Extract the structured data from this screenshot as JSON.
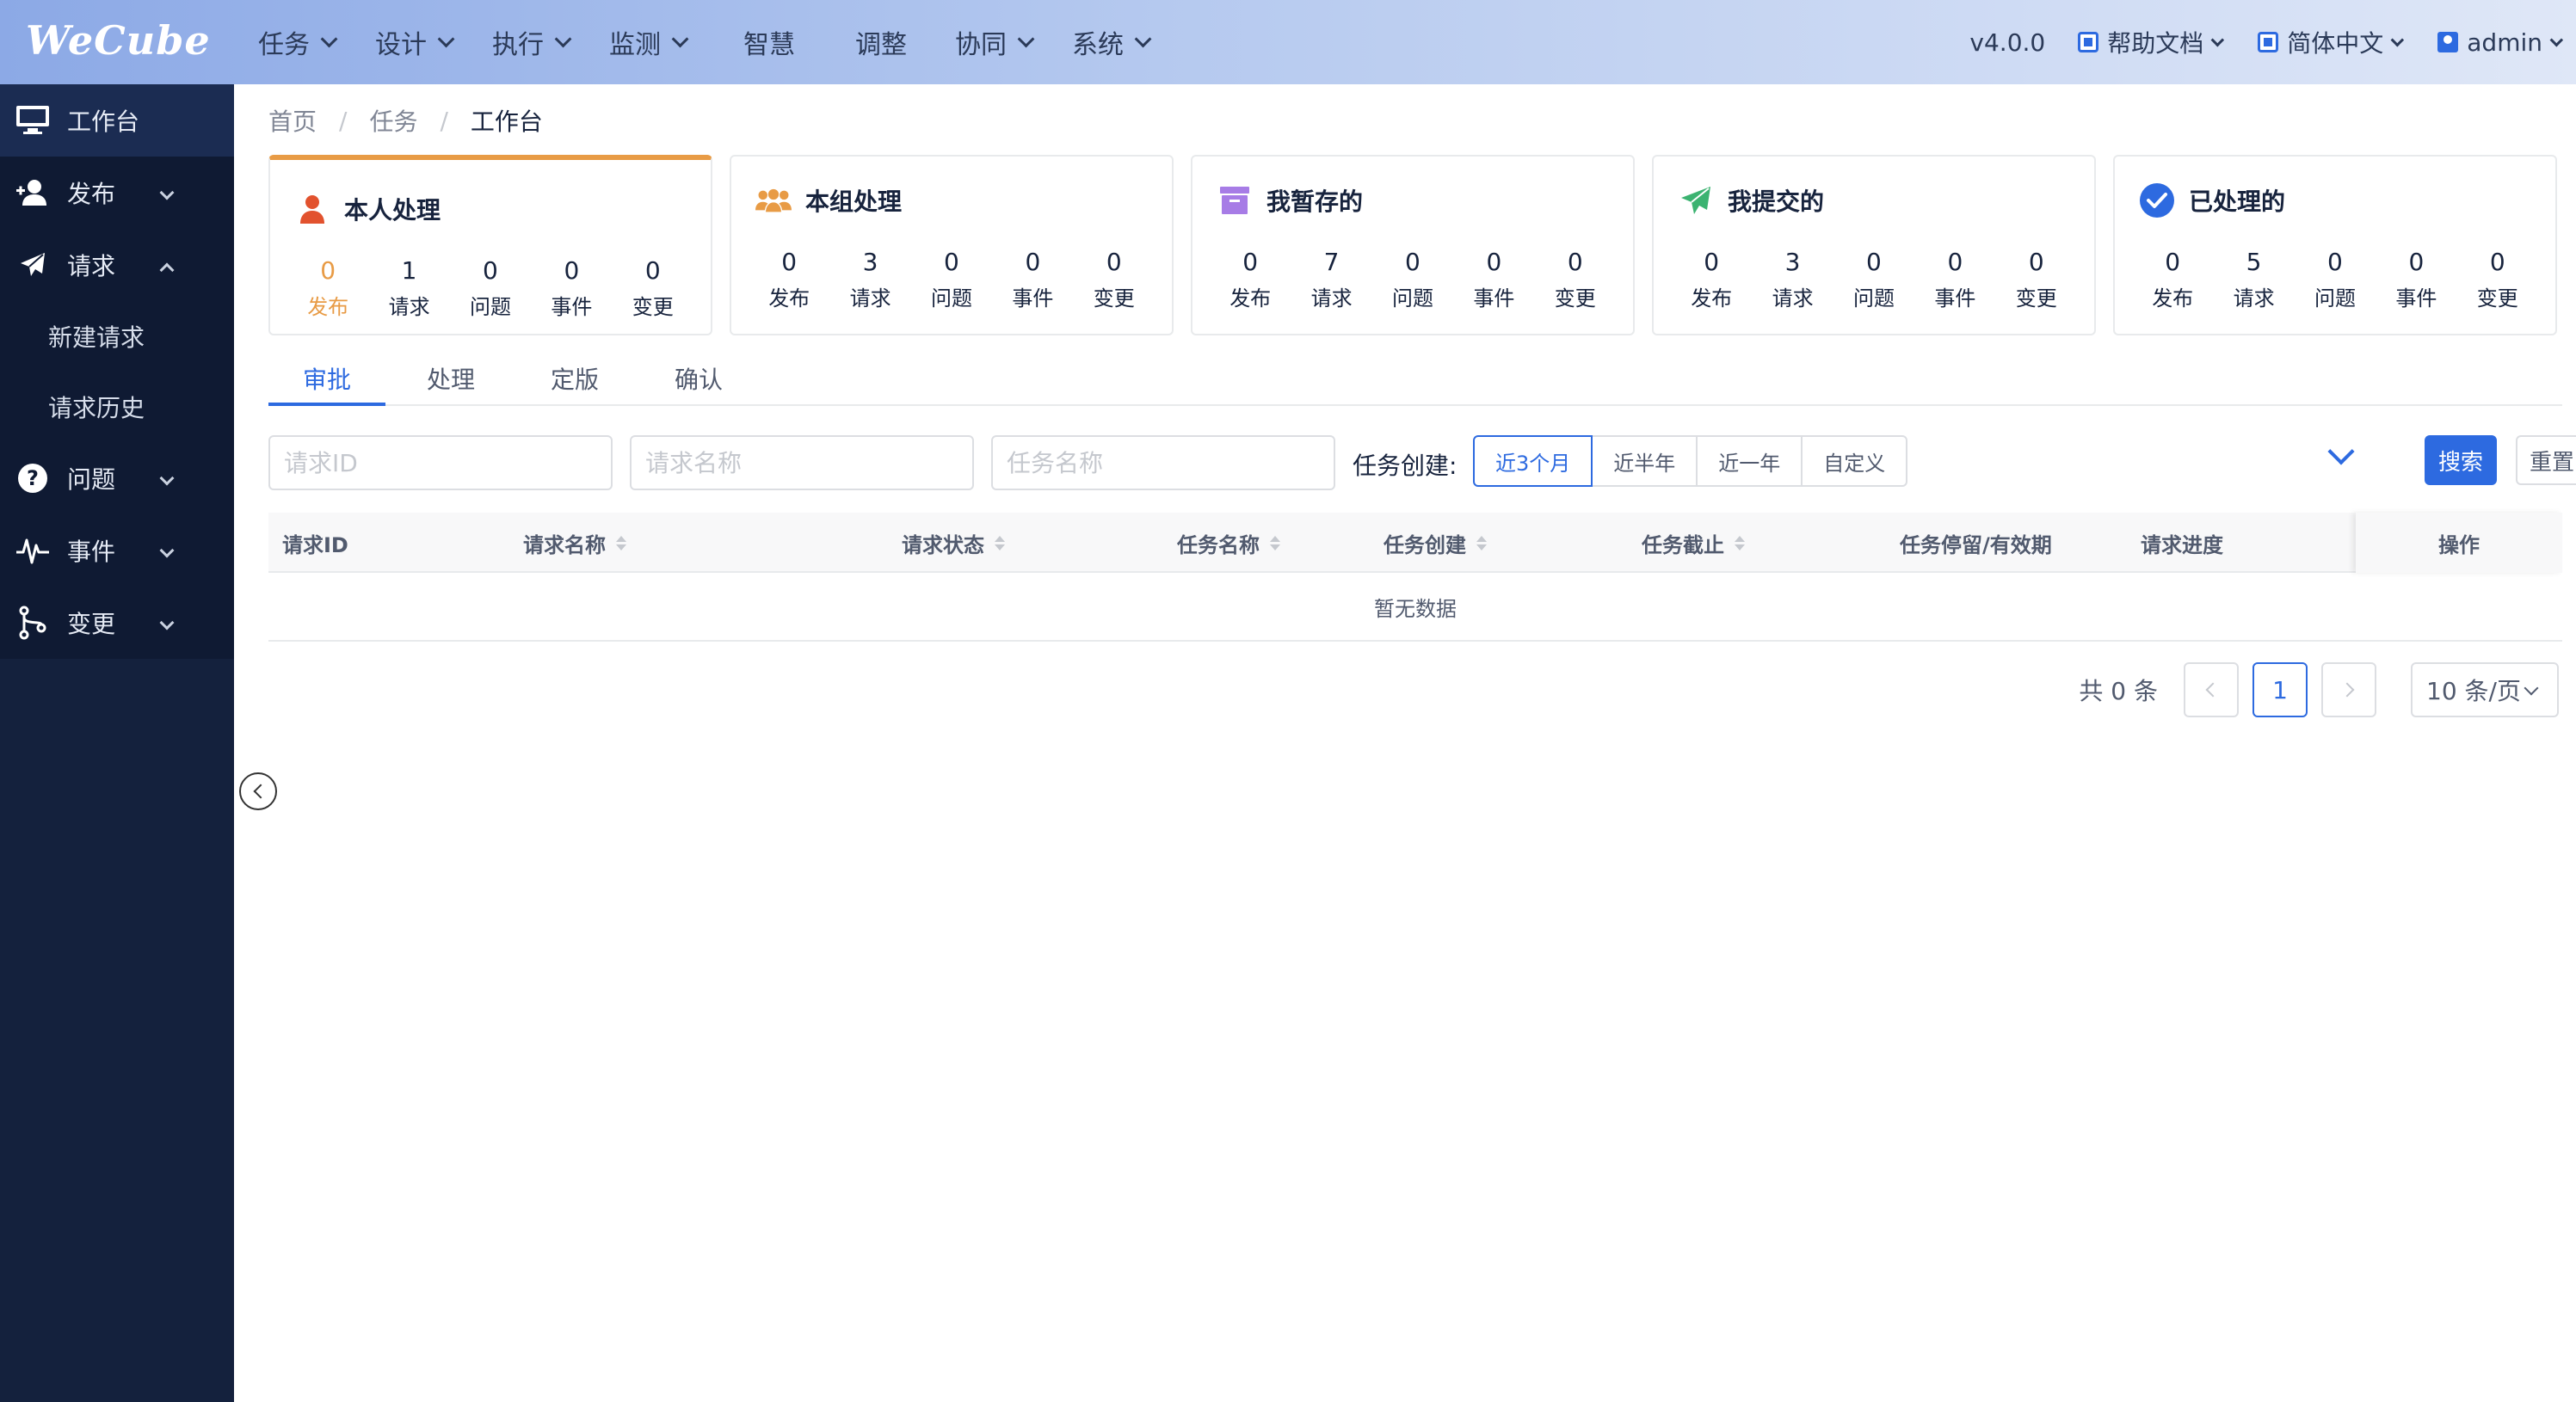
{
  "header": {
    "logo": "WeCube",
    "nav": [
      {
        "label": "任务",
        "dropdown": true
      },
      {
        "label": "设计",
        "dropdown": true
      },
      {
        "label": "执行",
        "dropdown": true
      },
      {
        "label": "监测",
        "dropdown": true
      },
      {
        "label": "智慧",
        "dropdown": false
      },
      {
        "label": "调整",
        "dropdown": false
      },
      {
        "label": "协同",
        "dropdown": true
      },
      {
        "label": "系统",
        "dropdown": true
      }
    ],
    "version": "v4.0.0",
    "help": "帮助文档",
    "language": "简体中文",
    "user": "admin"
  },
  "sidebar": {
    "items": [
      {
        "label": "工作台",
        "icon": "monitor-icon"
      },
      {
        "label": "发布",
        "icon": "user-add-icon"
      },
      {
        "label": "请求",
        "icon": "send-icon"
      },
      {
        "label": "新建请求"
      },
      {
        "label": "请求历史"
      },
      {
        "label": "问题",
        "icon": "question-icon"
      },
      {
        "label": "事件",
        "icon": "pulse-icon"
      },
      {
        "label": "变更",
        "icon": "branch-icon"
      }
    ]
  },
  "breadcrumb": [
    "首页",
    "任务",
    "工作台"
  ],
  "cards": [
    {
      "title": "本人处理",
      "icon": "person-icon",
      "color": "#e2522e",
      "stats": [
        {
          "num": "0",
          "label": "发布"
        },
        {
          "num": "1",
          "label": "请求"
        },
        {
          "num": "0",
          "label": "问题"
        },
        {
          "num": "0",
          "label": "事件"
        },
        {
          "num": "0",
          "label": "变更"
        }
      ]
    },
    {
      "title": "本组处理",
      "icon": "group-icon",
      "color": "#e89b45",
      "stats": [
        {
          "num": "0",
          "label": "发布"
        },
        {
          "num": "3",
          "label": "请求"
        },
        {
          "num": "0",
          "label": "问题"
        },
        {
          "num": "0",
          "label": "事件"
        },
        {
          "num": "0",
          "label": "变更"
        }
      ]
    },
    {
      "title": "我暂存的",
      "icon": "archive-icon",
      "color": "#a77ce6",
      "stats": [
        {
          "num": "0",
          "label": "发布"
        },
        {
          "num": "7",
          "label": "请求"
        },
        {
          "num": "0",
          "label": "问题"
        },
        {
          "num": "0",
          "label": "事件"
        },
        {
          "num": "0",
          "label": "变更"
        }
      ]
    },
    {
      "title": "我提交的",
      "icon": "paper-plane-icon",
      "color": "#3cb371",
      "stats": [
        {
          "num": "0",
          "label": "发布"
        },
        {
          "num": "3",
          "label": "请求"
        },
        {
          "num": "0",
          "label": "问题"
        },
        {
          "num": "0",
          "label": "事件"
        },
        {
          "num": "0",
          "label": "变更"
        }
      ]
    },
    {
      "title": "已处理的",
      "icon": "check-circle-icon",
      "color": "#2d6ae0",
      "stats": [
        {
          "num": "0",
          "label": "发布"
        },
        {
          "num": "5",
          "label": "请求"
        },
        {
          "num": "0",
          "label": "问题"
        },
        {
          "num": "0",
          "label": "事件"
        },
        {
          "num": "0",
          "label": "变更"
        }
      ]
    }
  ],
  "tabs": [
    "审批",
    "处理",
    "定版",
    "确认"
  ],
  "filters": {
    "placeholders": [
      "请求ID",
      "请求名称",
      "任务名称"
    ],
    "date_label": "任务创建:",
    "ranges": [
      "近3个月",
      "近半年",
      "近一年",
      "自定义"
    ],
    "search": "搜索",
    "reset": "重置"
  },
  "table": {
    "columns": [
      "请求ID",
      "请求名称",
      "请求状态",
      "任务名称",
      "任务创建",
      "任务截止",
      "任务停留/有效期",
      "请求进度"
    ],
    "action": "操作",
    "empty": "暂无数据"
  },
  "pagination": {
    "total": "共 0 条",
    "current": "1",
    "page_size": "10 条/页"
  },
  "colors": {
    "primary": "#2d6ae0",
    "accent": "#e89b45",
    "sidebar": "#14213d"
  }
}
